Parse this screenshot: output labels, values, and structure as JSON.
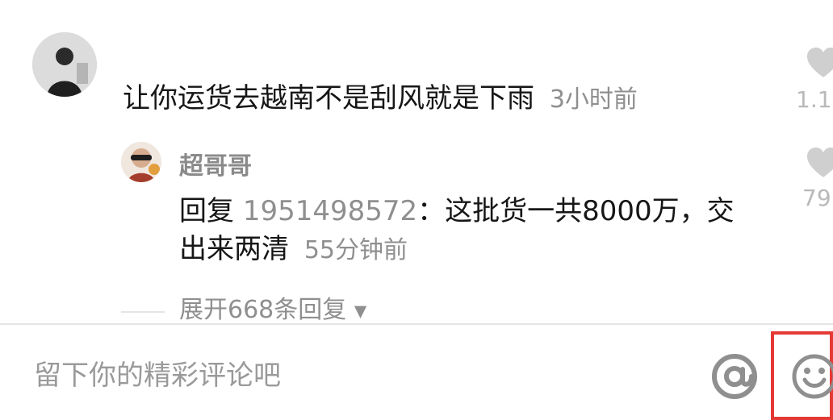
{
  "comments": [
    {
      "text": "让你运货去越南不是刮风就是下雨",
      "time": "3小时前",
      "likes": "1.1",
      "avatar_icon": "user-avatar-dark-photo"
    }
  ],
  "reply": {
    "username": "超哥哥",
    "prefix": "回复",
    "mention": "1951498572",
    "line1": "：这批货一共8000万，交",
    "line2": "出来两清",
    "time": "55分钟前",
    "likes": "79",
    "avatar_icon": "user-avatar-sunglasses-photo"
  },
  "expand_replies": {
    "label": "展开668条回复",
    "icon": "caret-down-icon"
  },
  "comment_input": {
    "placeholder": "留下你的精彩评论吧"
  },
  "toolbar": {
    "mention_icon": "at-icon",
    "emoji_icon": "smile-emoji-icon",
    "highlight_color": "#e53935"
  }
}
